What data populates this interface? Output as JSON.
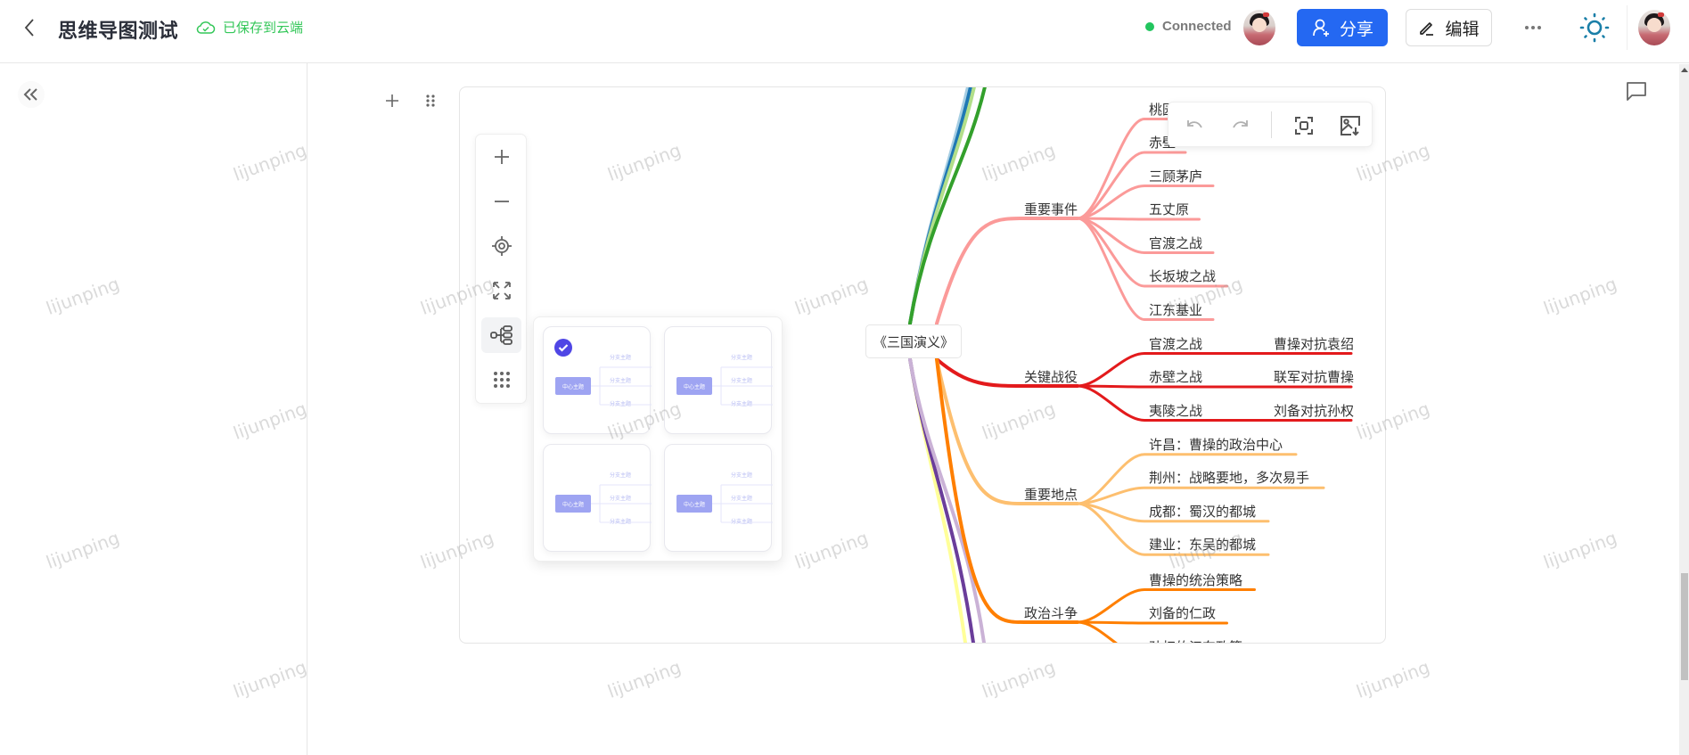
{
  "header": {
    "title": "思维导图测试",
    "save_status": "已保存到云端",
    "connection_status": "Connected",
    "share_label": "分享",
    "edit_label": "编辑"
  },
  "colors": {
    "accent": "#2468f2",
    "saved_green": "#34c759",
    "connected_dot": "#22c55e",
    "theme_icon": "#1a7fa8",
    "selected_check": "#4f46e5"
  },
  "mindmap": {
    "root": "《三国演义》",
    "branches": [
      {
        "label": "重要事件",
        "color": "#fb9a99",
        "children": [
          {
            "label": "桃园"
          },
          {
            "label": "赤壁"
          },
          {
            "label": "三顾茅庐"
          },
          {
            "label": "五丈原"
          },
          {
            "label": "官渡之战"
          },
          {
            "label": "长坂坡之战"
          },
          {
            "label": "江东基业"
          }
        ]
      },
      {
        "label": "关键战役",
        "color": "#e31a1c",
        "children": [
          {
            "label": "官渡之战",
            "child": "曹操对抗袁绍"
          },
          {
            "label": "赤壁之战",
            "child": "联军对抗曹操"
          },
          {
            "label": "夷陵之战",
            "child": "刘备对抗孙权"
          }
        ]
      },
      {
        "label": "重要地点",
        "color": "#fdbf6f",
        "children": [
          {
            "label": "许昌：曹操的政治中心"
          },
          {
            "label": "荆州：战略要地，多次易手"
          },
          {
            "label": "成都：蜀汉的都城"
          },
          {
            "label": "建业：东吴的都城"
          }
        ]
      },
      {
        "label": "政治斗争",
        "color": "#ff7f00",
        "children": [
          {
            "label": "曹操的统治策略"
          },
          {
            "label": "刘备的仁政"
          },
          {
            "label": "孙权的江东政策"
          }
        ]
      }
    ],
    "offscreen_branch_colors_top": [
      "#a6cee3",
      "#1f78b4",
      "#b2df8a",
      "#33a02c"
    ],
    "offscreen_branch_colors_bottom": [
      "#ffff99",
      "#6a3d9a",
      "#cab2d6"
    ]
  },
  "layout_panel": {
    "options": [
      {
        "center": "中心主题",
        "branches": [
          "分支主题",
          "分支主题",
          "分支主题"
        ],
        "selected": true
      },
      {
        "center": "中心主题",
        "branches": [
          "分支主题",
          "分支主题",
          "分支主题"
        ],
        "selected": false
      },
      {
        "center": "中心主题",
        "branches": [
          "分支主题",
          "分支主题",
          "分支主题"
        ],
        "selected": false
      },
      {
        "center": "中心主题",
        "branches": [
          "分支主题",
          "分支主题",
          "分支主题"
        ],
        "selected": false
      }
    ]
  },
  "watermark": "lijunping"
}
